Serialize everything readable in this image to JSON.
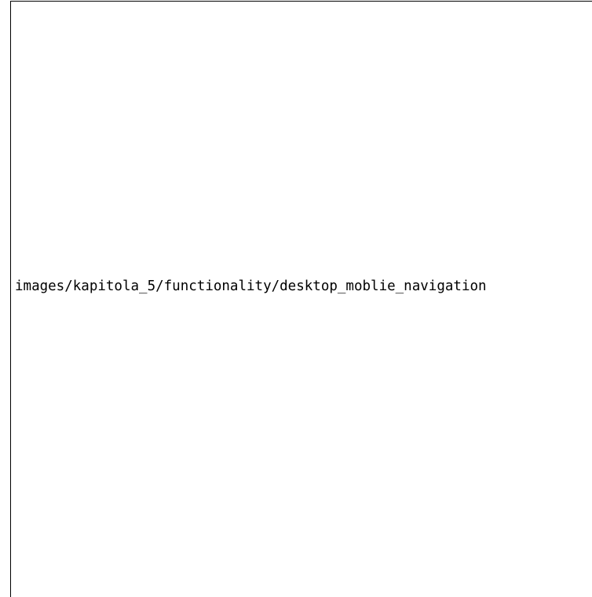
{
  "placeholder": {
    "path_text": "images/kapitola_5/functionality/desktop_moblie_navigation"
  },
  "colors": {
    "background": "#ffffff",
    "border": "#000000",
    "text": "#000000"
  }
}
